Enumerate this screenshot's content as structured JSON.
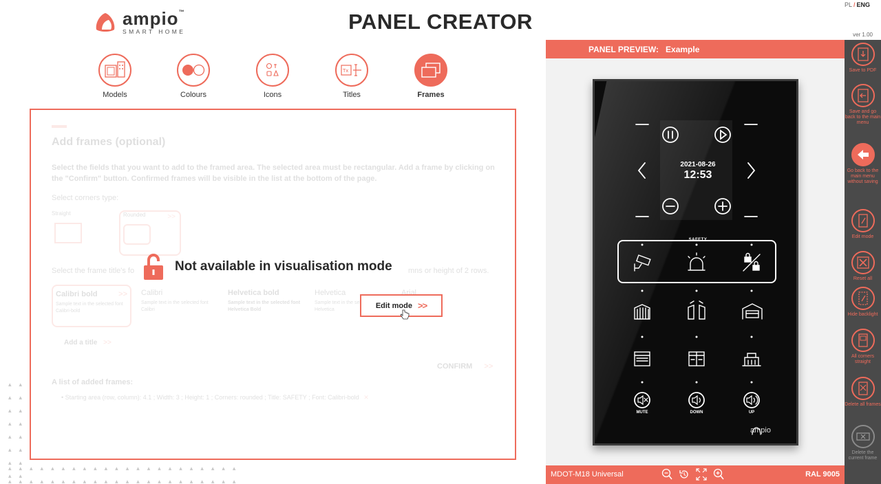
{
  "header": {
    "brand_name": "ampio",
    "brand_tm": "™",
    "brand_sub": "SMART HOME",
    "title": "PANEL CREATOR",
    "lang_pl": "PL",
    "lang_sep": "/",
    "lang_eng": "ENG",
    "version": "ver 1.00"
  },
  "steps": [
    {
      "label": "Models",
      "icon": "models-icon"
    },
    {
      "label": "Colours",
      "icon": "colours-icon"
    },
    {
      "label": "Icons",
      "icon": "icons-icon"
    },
    {
      "label": "Titles",
      "icon": "titles-icon"
    },
    {
      "label": "Frames",
      "icon": "frames-icon",
      "active": true
    }
  ],
  "frames": {
    "heading": "Add frames (optional)",
    "description": "Select the fields that you want to add to the framed area. The selected area must be rectangular. Add a frame by clicking on the \"Confirm\" button. Confirmed frames will be visible in the list at the bottom of the page.",
    "corners_label": "Select corners type:",
    "corner_straight": "Straight",
    "corner_rounded": "Rounded",
    "corner_chevron": ">>",
    "font_label": "Select the frame title's fo",
    "font_label_right": "mns or height of 2 rows.",
    "fonts": [
      {
        "name": "Calibri bold",
        "sample": "Sample text in the selected font Calibri-bold",
        "chevron": ">>"
      },
      {
        "name": "Calibri",
        "sample": "Sample text in the selected font Calibri"
      },
      {
        "name": "Helvetica bold",
        "sample": "Sample text in the selected font Helvetica Bold"
      },
      {
        "name": "Helvetica",
        "sample": "Sample text in the sel font Helvetica"
      },
      {
        "name": "Arial",
        "sample": "ected"
      }
    ],
    "add_title": "Add a title",
    "add_title_chev": ">>",
    "confirm": "CONFIRM",
    "confirm_chev": ">>",
    "list_title": "A list of added frames:",
    "list_item": "Starting area (row, column): 4.1 ; Width: 3 ; Height: 1 ; Corners: rounded ; Title: SAFETY ; Font: Calibri-bold",
    "list_item_remove": "✕",
    "not_available": "Not available in visualisation mode",
    "edit_mode": "Edit mode",
    "edit_mode_chev": ">>"
  },
  "preview": {
    "header_label": "PANEL PREVIEW:",
    "panel_name": "Example",
    "date": "2021-08-26",
    "time": "12:53",
    "frame_title": "SAFETY",
    "labels": [
      "MUTE",
      "DOWN",
      "UP"
    ],
    "brand": "ampio",
    "model": "MDOT-M18 Universal",
    "ral": "RAL 9005",
    "zoom_tools": [
      "zoom-out-icon",
      "reset-icon",
      "fit-screen-icon",
      "zoom-in-icon"
    ]
  },
  "toolbar": [
    {
      "label": "Save to PDF",
      "icon": "save-pdf-icon"
    },
    {
      "label": "Save and go back to the main menu",
      "icon": "save-back-icon"
    },
    {
      "label": "Go back to the main menu without saving",
      "icon": "back-arrow-icon"
    },
    {
      "label": "Edit mode",
      "icon": "edit-mode-icon"
    },
    {
      "label": "Reset all",
      "icon": "reset-all-icon"
    },
    {
      "label": "Hide backlight",
      "icon": "backlight-icon"
    },
    {
      "label": "All corners straight",
      "icon": "corners-icon"
    },
    {
      "label": "Delete all frames",
      "icon": "delete-frames-icon"
    },
    {
      "label": "Delete the current frame",
      "icon": "delete-frame-icon",
      "disabled": true
    }
  ],
  "colors": {
    "accent": "#ee6b5b",
    "toolbar_bg": "#4a4a4a",
    "panel_bg": "#0c0c0c"
  }
}
